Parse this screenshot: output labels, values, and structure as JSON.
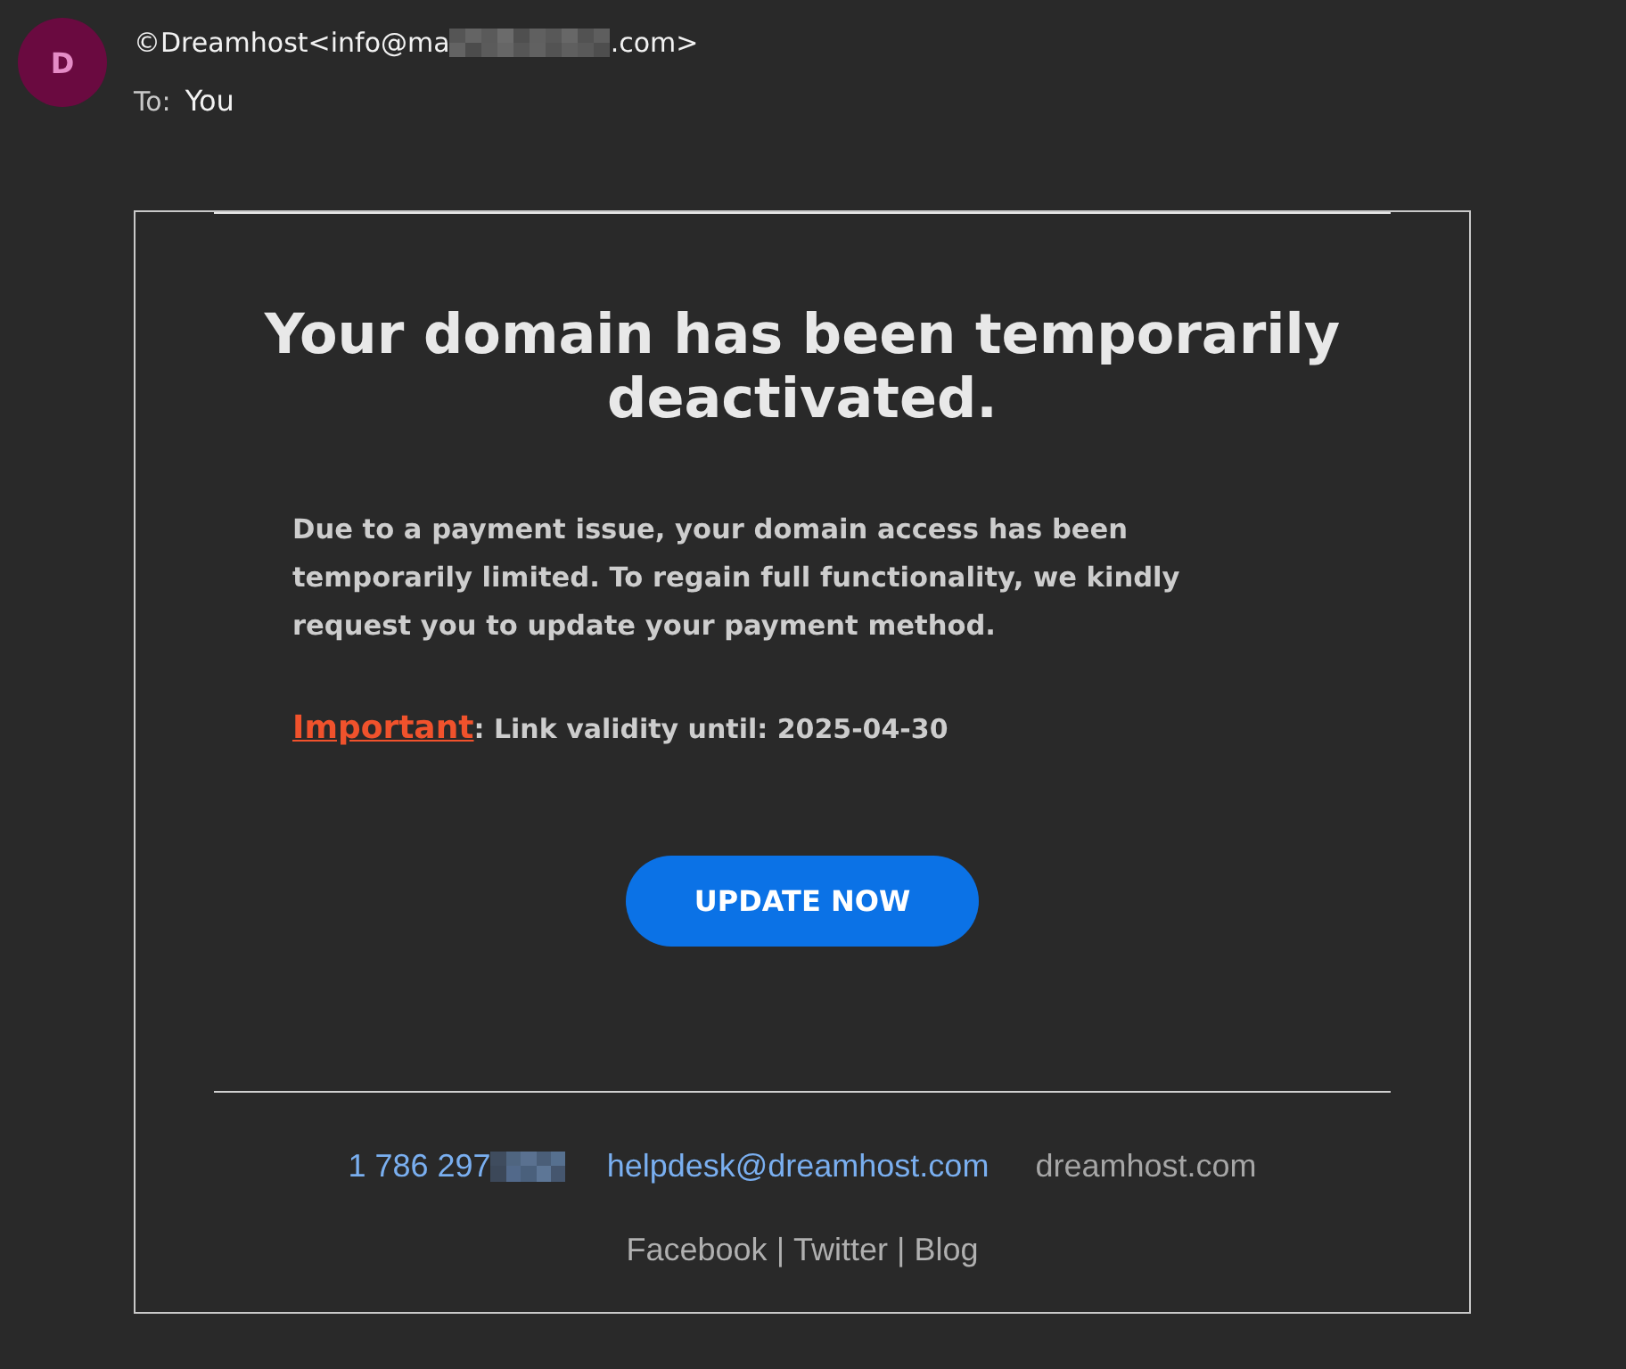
{
  "header": {
    "avatar": {
      "initial": "D"
    },
    "sender": {
      "visible_start": "©Dreamhost<info@ma",
      "redacted": true,
      "visible_end": ".com>"
    },
    "recipient": {
      "label": "To:",
      "name": "You"
    }
  },
  "message": {
    "heading": "Your domain has been temporarily deactivated.",
    "body": "Due to a payment issue, your domain access has been temporarily limited. To regain full functionality, we kindly request you to update your payment method.",
    "notice": {
      "link": "Important",
      "text": ": Link validity until: 2025-04-30"
    },
    "button": "UPDATE NOW"
  },
  "footer": {
    "contacts": [
      {
        "kind": "phone",
        "text": "1 786 297",
        "redacted": true
      },
      {
        "kind": "email",
        "text": "helpdesk@dreamhost.com"
      },
      {
        "kind": "website",
        "text": "dreamhost.com"
      }
    ],
    "social_links": [
      "Facebook",
      "Twitter",
      "Blog"
    ],
    "separators": [
      "|",
      "|"
    ]
  }
}
